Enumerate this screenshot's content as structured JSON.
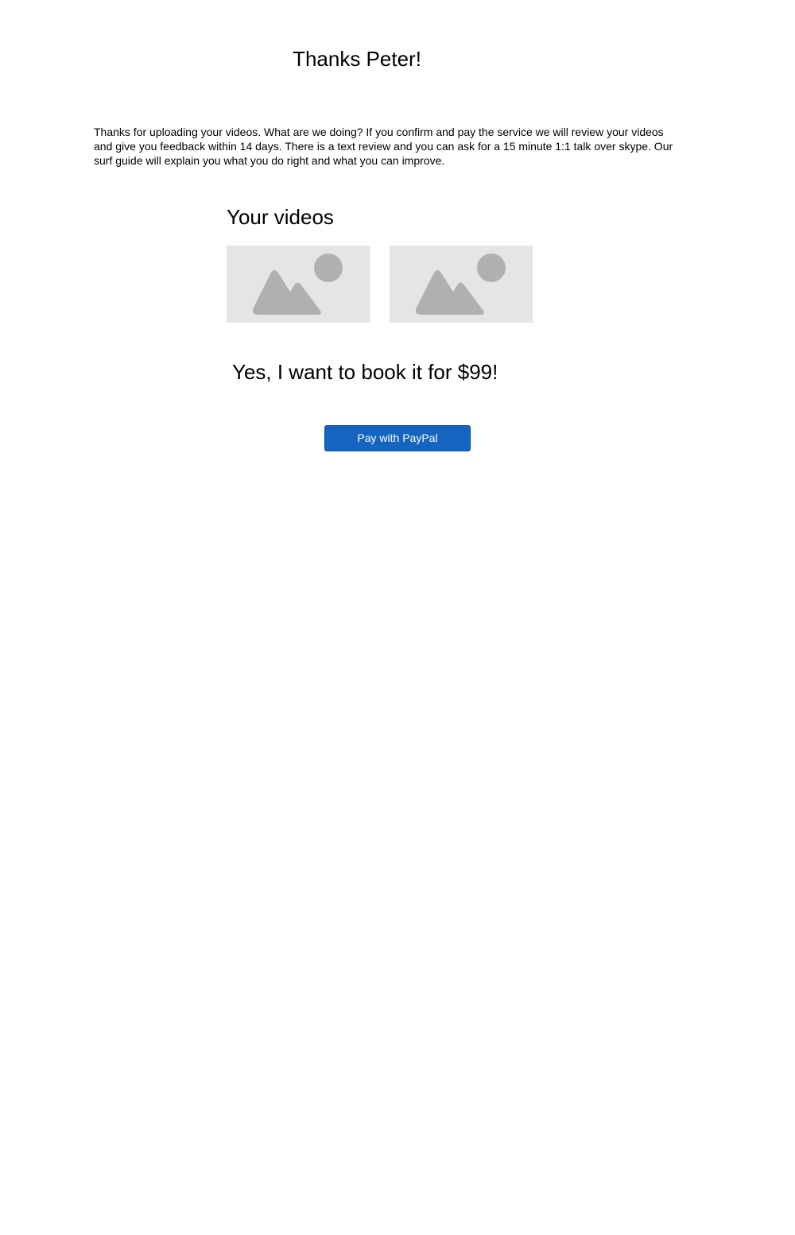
{
  "page": {
    "title": "Thanks Peter!",
    "intro": "Thanks for uploading your videos. What are we doing? If you confirm and pay the service we will review your videos and give you feedback within 14 days. There is a text review and you can ask for a 15 minute 1:1 talk over skype. Our surf guide will explain you what you do right and what you can improve."
  },
  "videos": {
    "heading": "Your videos",
    "items": [
      {
        "icon": "image-placeholder-icon"
      },
      {
        "icon": "image-placeholder-icon"
      }
    ]
  },
  "booking": {
    "heading": "Yes, I want to book it for $99!",
    "pay_button_label": "Pay with PayPal",
    "pay_button_color": "#1565c0"
  },
  "colors": {
    "placeholder_bg": "#e5e5e5",
    "placeholder_shape": "#b0b0b0"
  }
}
